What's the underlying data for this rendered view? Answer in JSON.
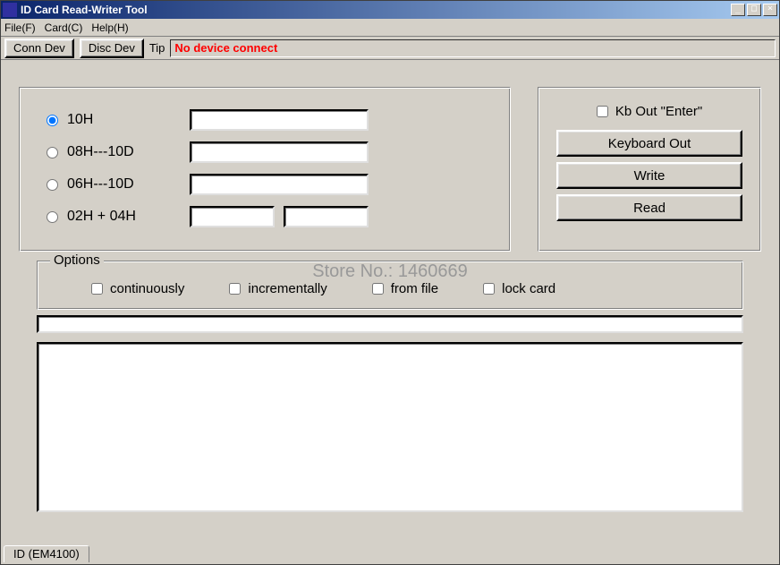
{
  "title": "ID Card Read-Writer Tool",
  "menus": {
    "file": "File(F)",
    "card": "Card(C)",
    "help": "Help(H)"
  },
  "toolbar": {
    "conn": "Conn Dev",
    "disc": "Disc Dev",
    "tip_label": "Tip",
    "tip_value": "No device connect"
  },
  "formats": {
    "opt1": "10H",
    "opt2": "08H---10D",
    "opt3": "06H---10D",
    "opt4": "02H + 04H",
    "selected": "opt1",
    "val1": "",
    "val2": "",
    "val3": "",
    "val4a": "",
    "val4b": ""
  },
  "right": {
    "kbout": "Kb Out \"Enter\"",
    "keyboard_out": "Keyboard Out",
    "write": "Write",
    "read": "Read"
  },
  "options": {
    "legend": "Options",
    "continuously": "continuously",
    "incrementally": "incrementally",
    "from_file": "from file",
    "lock_card": "lock card"
  },
  "tab": "ID (EM4100)",
  "watermark": "Store No.: 1460669"
}
